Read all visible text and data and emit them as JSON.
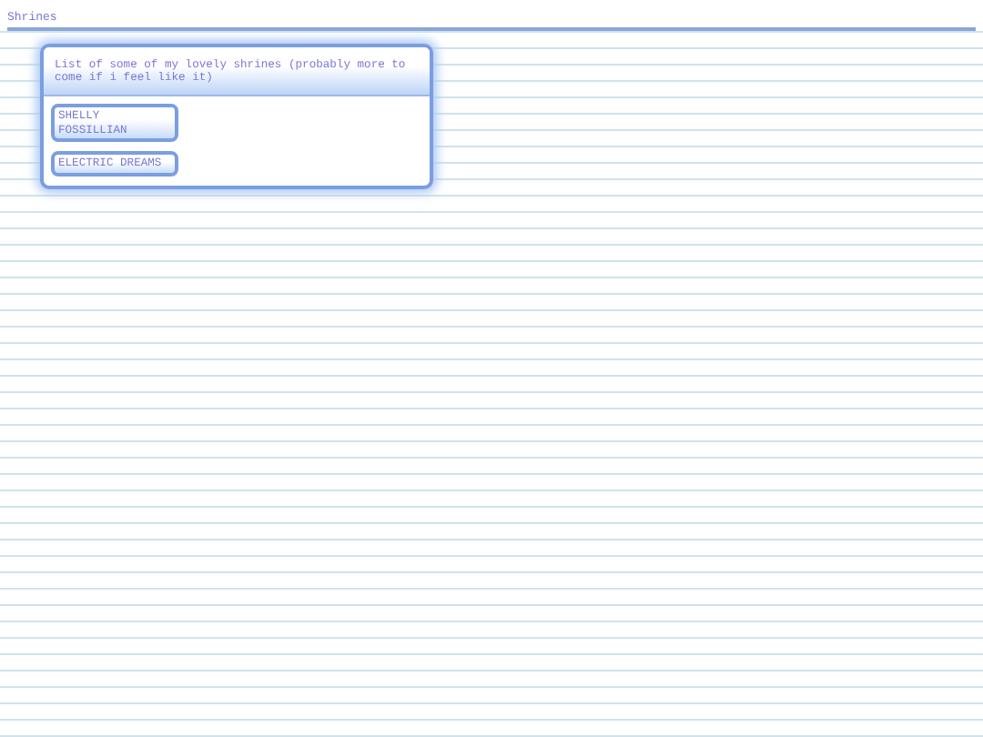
{
  "page_title": "Shrines",
  "panel": {
    "heading": "List of some of my lovely shrines (probably more to come if i feel like it)",
    "links": [
      {
        "label": "SHELLY FOSSILLIAN"
      },
      {
        "label": "ELECTRIC DREAMS"
      }
    ]
  }
}
